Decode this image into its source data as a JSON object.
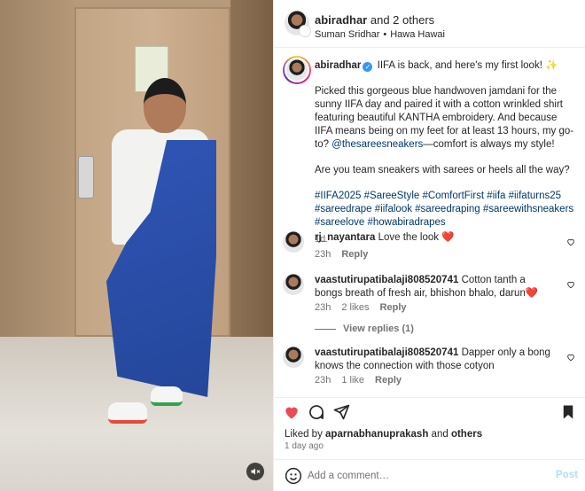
{
  "media": {
    "alt_icon": "mute-icon"
  },
  "header": {
    "username": "abiradhar",
    "collaborators": "and 2 others",
    "sub_user": "Suman Sridhar",
    "sub_sep": "•",
    "sub_audio": "Hawa Hawai"
  },
  "caption": {
    "username": "abiradhar",
    "line1": "IIFA is back, and here's my first look! ✨",
    "para1_a": "Picked this gorgeous blue handwoven jamdani for the sunny IIFA day and paired it with a cotton wrinkled shirt featuring beautiful KANTHA embroidery. And because IIFA means being on my feet for at least 13 hours, my go-to? ",
    "para1_mention": "@thesareesneakers",
    "para1_b": "—comfort is always my style!",
    "para2": "Are you team sneakers with sarees or heels all the way?",
    "hashtags": "#IIFA2025 #SareeStyle #ComfortFirst #iifa #iifaturns25 #sareedrape #iifalook #sareedraping #sareewithsneakers #sareelove #howabiradrapes",
    "time": "1d"
  },
  "comments": [
    {
      "username": "rj_nayantara",
      "text": "Love the look ❤️",
      "time": "23h",
      "likes": "",
      "reply": "Reply"
    },
    {
      "username": "vaastutirupatibalaji808520741",
      "text": "Cotton tanth a bongs breath of fresh air, bhishon bhalo, darun❤️",
      "time": "23h",
      "likes": "2 likes",
      "reply": "Reply"
    },
    {
      "username": "vaastutirupatibalaji808520741",
      "text": "Dapper only a bong knows the connection with those cotyon",
      "time": "23h",
      "likes": "1 like",
      "reply": "Reply"
    }
  ],
  "view_replies": "View replies (1)",
  "liked_by": {
    "prefix": "Liked by ",
    "user": "aparnabhanuprakash",
    "and": " and ",
    "others": "others"
  },
  "posted_ago": "1 day ago",
  "add_comment": {
    "placeholder": "Add a comment…",
    "post_label": "Post"
  },
  "colors": {
    "like_red": "#ed4956",
    "link_blue": "#00376b",
    "post_disabled": "#b2dffc",
    "verified_blue": "#3897f0"
  }
}
